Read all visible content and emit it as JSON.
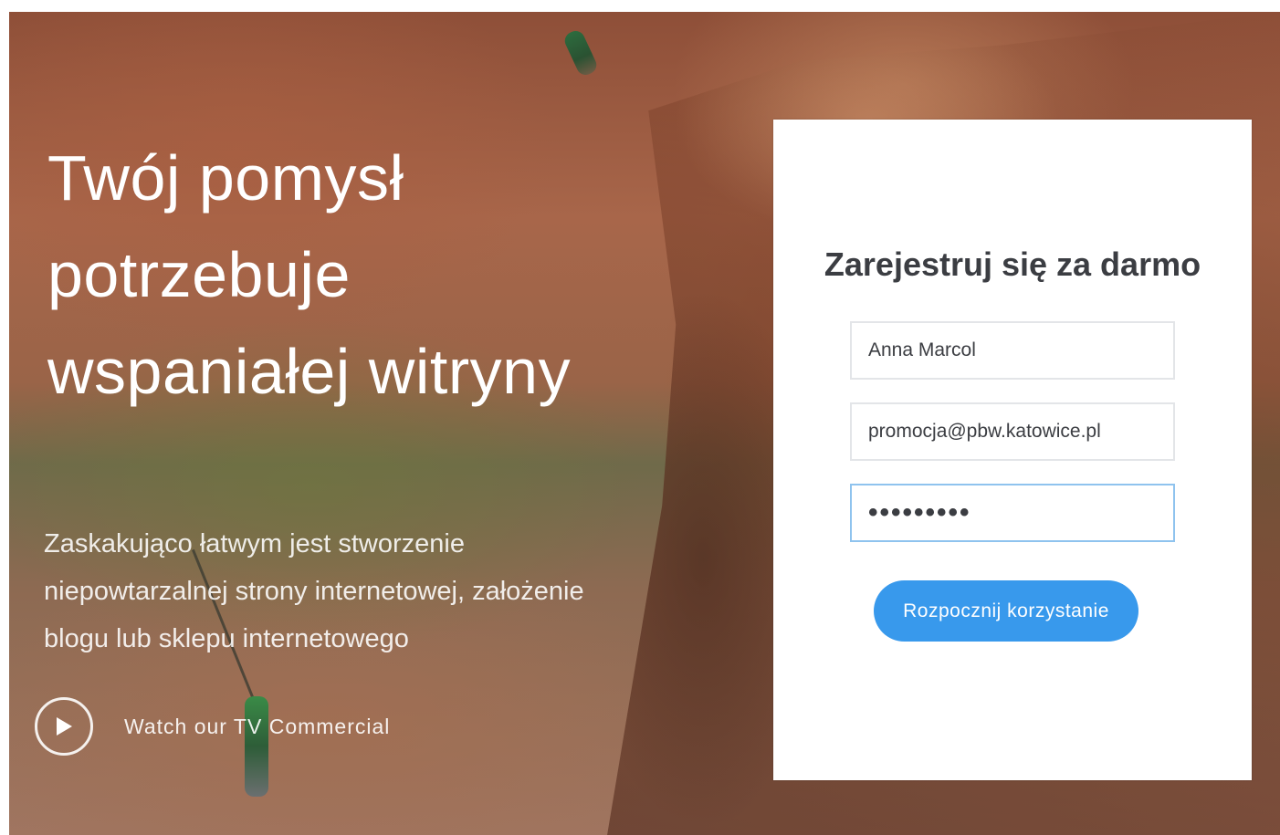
{
  "hero": {
    "headline": "Twój pomysł potrzebuje wspaniałej witryny",
    "subtext": "Zaskakująco łatwym jest stworzenie niepowtarzalnej strony internetowej, założenie blogu lub sklepu internetowego",
    "video_link": {
      "label": "Watch our TV Commercial",
      "icon": "play-icon"
    }
  },
  "signup": {
    "title": "Zarejestruj się za darmo",
    "fields": {
      "name": {
        "value": "Anna Marcol"
      },
      "email": {
        "value": "promocja@pbw.katowice.pl"
      },
      "password": {
        "value": "•••••••••"
      }
    },
    "submit_label": "Rozpocznij korzystanie",
    "accent_color": "#3899ec"
  }
}
